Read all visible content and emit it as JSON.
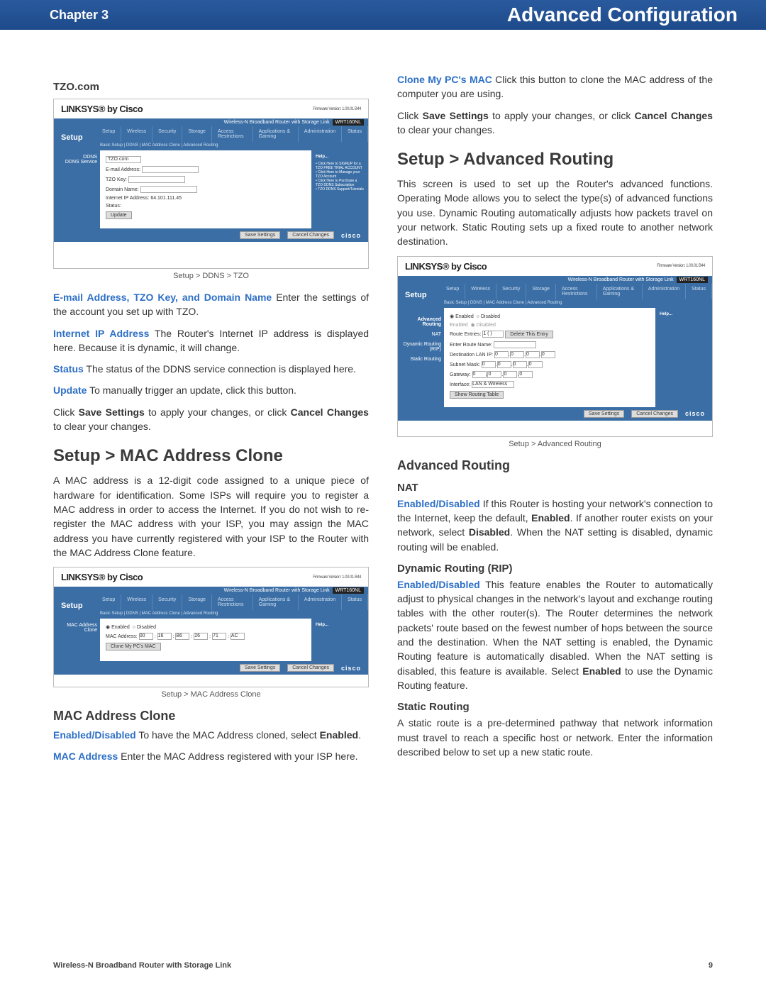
{
  "header": {
    "chapter": "Chapter 3",
    "title": "Advanced Configuration"
  },
  "left": {
    "tzo_heading": "TZO.com",
    "ss1": {
      "logo": "LINKSYS® by Cisco",
      "firmware": "Firmware Version: 1.00.01 B44",
      "model_line": "Wireless-N Broadband Router with Storage Link",
      "model": "WRT160NL",
      "setup": "Setup",
      "tabs": [
        "Setup",
        "Wireless",
        "Security",
        "Storage",
        "Access Restrictions",
        "Applications & Gaming",
        "Administration",
        "Status"
      ],
      "subtabs": "Basic Setup  |  DDNS  |  MAC Address Clone  |  Advanced Routing",
      "side": "DDNS\nDDNS Service",
      "content": {
        "service": "TZO.com",
        "labels": [
          "E-mail Address:",
          "TZO Key:",
          "Domain Name:",
          "Internet IP Address:",
          "Status:"
        ],
        "ip": "64.101.111.45",
        "update_btn": "Update"
      },
      "help": {
        "title": "Help...",
        "items": [
          "Click Here to SIGNUP for a TZO FREE TRIAL ACCOUNT",
          "Click Here to Manage your TZO Account",
          "Click Here to Purchase a TZO DDNS Subscription",
          "TZO DDNS Support/Tutorials"
        ]
      },
      "save": "Save Settings",
      "cancel": "Cancel Changes",
      "cisco": "cisco"
    },
    "caption1": "Setup > DDNS > TZO",
    "p1a": "E-mail Address, TZO Key, and Domain Name",
    "p1b": "  Enter the settings of the account you set up with TZO.",
    "p2a": "Internet IP Address",
    "p2b": "  The Router's Internet IP address is displayed here. Because it is dynamic, it will change.",
    "p3a": "Status",
    "p3b": "  The status of the DDNS service connection is displayed here.",
    "p4a": "Update",
    "p4b": "  To manually trigger an update, click this button.",
    "p5": "Click Save Settings to apply your changes, or click Cancel Changes to clear your changes.",
    "h2_mac": "Setup > MAC Address Clone",
    "p6": "A MAC address is a 12-digit code assigned to a unique piece of hardware for identification. Some ISPs will require you to register a MAC address in order to access the Internet. If you do not wish to re-register the MAC address with your ISP, you may assign the MAC address you have currently registered with your ISP to the Router with the MAC Address Clone feature.",
    "ss2": {
      "side": "MAC Address Clone",
      "enabled": "Enabled",
      "disabled": "Disabled",
      "label": "MAC Address:",
      "vals": [
        "00",
        "16",
        "B6",
        "26",
        "71",
        "AC"
      ],
      "btn": "Clone My PC's MAC"
    },
    "caption2": "Setup > MAC Address Clone",
    "h3_mac": "MAC Address Clone",
    "p7a": "Enabled/Disabled",
    "p7b": "  To have the MAC Address cloned, select Enabled.",
    "p8a": "MAC Address",
    "p8b": "  Enter the MAC Address registered with your ISP here."
  },
  "right": {
    "p1a": "Clone My PC's MAC",
    "p1b": "  Click this button to clone the MAC address of the computer you are using.",
    "p2": "Click Save Settings to apply your changes, or click Cancel Changes to clear your changes.",
    "h2_ar": "Setup > Advanced Routing",
    "p3": "This screen is used to set up the Router's advanced functions. Operating Mode allows you to select the type(s) of advanced functions you use. Dynamic Routing automatically adjusts how packets travel on your network. Static Routing sets up a fixed route to another network destination.",
    "ss3": {
      "side_lines": [
        "Advanced Routing",
        "NAT",
        "Dynamic Routing (RIP)",
        "Static Routing"
      ],
      "nat": [
        "Enabled",
        "Disabled"
      ],
      "rip": [
        "Enabled",
        "Disabled"
      ],
      "route_entries": "Route Entries:",
      "route_sel": "1 ( )",
      "del_btn": "Delete This Entry",
      "rows": [
        "Enter Route Name:",
        "Destination LAN IP:",
        "Subnet Mask:",
        "Gateway:",
        "Interface:"
      ],
      "iface": "LAN & Wireless",
      "show_btn": "Show Routing Table",
      "help": "Help..."
    },
    "caption3": "Setup > Advanced Routing",
    "h3_ar": "Advanced Routing",
    "h4_nat": "NAT",
    "p4a": "Enabled/Disabled",
    "p4b": "  If this Router is hosting your network's connection to the Internet, keep the default, Enabled. If another router exists on your network, select Disabled. When the NAT setting is disabled, dynamic routing will be enabled.",
    "h4_rip": "Dynamic Routing (RIP)",
    "p5a": "Enabled/Disabled",
    "p5b": "  This feature enables the Router to automatically adjust to physical changes in the network's layout and exchange routing tables with the other router(s). The Router determines the network packets' route based on the fewest number of hops between the source and the destination. When the NAT setting is enabled, the Dynamic Routing feature is automatically disabled. When the NAT setting is disabled, this feature is available. Select Enabled to use the Dynamic Routing feature.",
    "h4_sr": "Static Routing",
    "p6": "A static route is a pre-determined pathway that network information must travel to reach a specific host or network. Enter the information described below to set up a new static route."
  },
  "footer": {
    "left": "Wireless-N Broadband Router with Storage Link",
    "page": "9"
  }
}
